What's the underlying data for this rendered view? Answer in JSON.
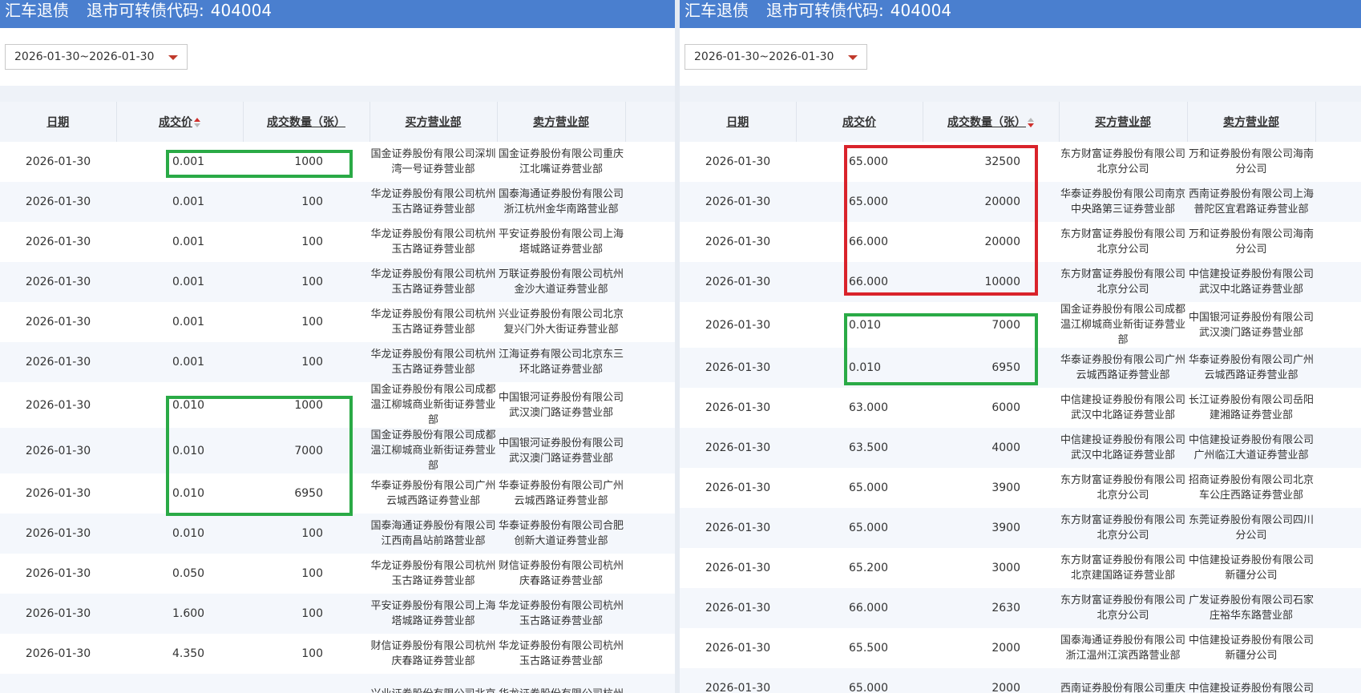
{
  "left": {
    "title": "汇车退债",
    "code_label": "退市可转债代码:",
    "code_value": "404004",
    "date_range": "2026-01-30~2026-01-30",
    "columns": [
      "日期",
      "成交价",
      "成交数量（张）",
      "买方营业部",
      "卖方营业部"
    ],
    "rows": [
      {
        "date": "2026-01-30",
        "price": "0.001",
        "qty": "1000",
        "buyer": "国金证券股份有限公司深圳湾一号证券营业部",
        "seller": "国金证券股份有限公司重庆江北嘴证券营业部"
      },
      {
        "date": "2026-01-30",
        "price": "0.001",
        "qty": "100",
        "buyer": "华龙证券股份有限公司杭州玉古路证券营业部",
        "seller": "国泰海通证券股份有限公司浙江杭州金华南路营业部"
      },
      {
        "date": "2026-01-30",
        "price": "0.001",
        "qty": "100",
        "buyer": "华龙证券股份有限公司杭州玉古路证券营业部",
        "seller": "平安证券股份有限公司上海塔城路证券营业部"
      },
      {
        "date": "2026-01-30",
        "price": "0.001",
        "qty": "100",
        "buyer": "华龙证券股份有限公司杭州玉古路证券营业部",
        "seller": "万联证券股份有限公司杭州金沙大道证券营业部"
      },
      {
        "date": "2026-01-30",
        "price": "0.001",
        "qty": "100",
        "buyer": "华龙证券股份有限公司杭州玉古路证券营业部",
        "seller": "兴业证券股份有限公司北京复兴门外大街证券营业部"
      },
      {
        "date": "2026-01-30",
        "price": "0.001",
        "qty": "100",
        "buyer": "华龙证券股份有限公司杭州玉古路证券营业部",
        "seller": "江海证券有限公司北京东三环北路证券营业部"
      },
      {
        "date": "2026-01-30",
        "price": "0.010",
        "qty": "1000",
        "buyer": "国金证券股份有限公司成都温江柳城商业新街证券营业部",
        "seller": "中国银河证券股份有限公司武汉澳门路证券营业部"
      },
      {
        "date": "2026-01-30",
        "price": "0.010",
        "qty": "7000",
        "buyer": "国金证券股份有限公司成都温江柳城商业新街证券营业部",
        "seller": "中国银河证券股份有限公司武汉澳门路证券营业部"
      },
      {
        "date": "2026-01-30",
        "price": "0.010",
        "qty": "6950",
        "buyer": "华泰证券股份有限公司广州云城西路证券营业部",
        "seller": "华泰证券股份有限公司广州云城西路证券营业部"
      },
      {
        "date": "2026-01-30",
        "price": "0.010",
        "qty": "100",
        "buyer": "国泰海通证券股份有限公司江西南昌站前路营业部",
        "seller": "华泰证券股份有限公司合肥创新大道证券营业部"
      },
      {
        "date": "2026-01-30",
        "price": "0.050",
        "qty": "100",
        "buyer": "华龙证券股份有限公司杭州玉古路证券营业部",
        "seller": "财信证券股份有限公司杭州庆春路证券营业部"
      },
      {
        "date": "2026-01-30",
        "price": "1.600",
        "qty": "100",
        "buyer": "平安证券股份有限公司上海塔城路证券营业部",
        "seller": "华龙证券股份有限公司杭州玉古路证券营业部"
      },
      {
        "date": "2026-01-30",
        "price": "4.350",
        "qty": "100",
        "buyer": "财信证券股份有限公司杭州庆春路证券营业部",
        "seller": "华龙证券股份有限公司杭州玉古路证券营业部"
      },
      {
        "date": "",
        "price": "",
        "qty": "",
        "buyer": "兴业证券股份有限公司北京",
        "seller": "华龙证券股份有限公司杭州"
      }
    ]
  },
  "right": {
    "title": "汇车退债",
    "code_label": "退市可转债代码:",
    "code_value": "404004",
    "date_range": "2026-01-30~2026-01-30",
    "columns": [
      "日期",
      "成交价",
      "成交数量（张）",
      "买方营业部",
      "卖方营业部"
    ],
    "rows": [
      {
        "date": "2026-01-30",
        "price": "65.000",
        "qty": "32500",
        "buyer": "东方财富证券股份有限公司北京分公司",
        "seller": "万和证券股份有限公司海南分公司"
      },
      {
        "date": "2026-01-30",
        "price": "65.000",
        "qty": "20000",
        "buyer": "华泰证券股份有限公司南京中央路第三证券营业部",
        "seller": "西南证券股份有限公司上海普陀区宜君路证券营业部"
      },
      {
        "date": "2026-01-30",
        "price": "66.000",
        "qty": "20000",
        "buyer": "东方财富证券股份有限公司北京分公司",
        "seller": "万和证券股份有限公司海南分公司"
      },
      {
        "date": "2026-01-30",
        "price": "66.000",
        "qty": "10000",
        "buyer": "东方财富证券股份有限公司北京分公司",
        "seller": "中信建投证券股份有限公司武汉中北路证券营业部"
      },
      {
        "date": "2026-01-30",
        "price": "0.010",
        "qty": "7000",
        "buyer": "国金证券股份有限公司成都温江柳城商业新街证券营业部",
        "seller": "中国银河证券股份有限公司武汉澳门路证券营业部"
      },
      {
        "date": "2026-01-30",
        "price": "0.010",
        "qty": "6950",
        "buyer": "华泰证券股份有限公司广州云城西路证券营业部",
        "seller": "华泰证券股份有限公司广州云城西路证券营业部"
      },
      {
        "date": "2026-01-30",
        "price": "63.000",
        "qty": "6000",
        "buyer": "中信建投证券股份有限公司武汉中北路证券营业部",
        "seller": "长江证券股份有限公司岳阳建湘路证券营业部"
      },
      {
        "date": "2026-01-30",
        "price": "63.500",
        "qty": "4000",
        "buyer": "中信建投证券股份有限公司武汉中北路证券营业部",
        "seller": "中信建投证券股份有限公司广州临江大道证券营业部"
      },
      {
        "date": "2026-01-30",
        "price": "65.000",
        "qty": "3900",
        "buyer": "东方财富证券股份有限公司北京分公司",
        "seller": "招商证券股份有限公司北京车公庄西路证券营业部"
      },
      {
        "date": "2026-01-30",
        "price": "65.000",
        "qty": "3900",
        "buyer": "东方财富证券股份有限公司北京分公司",
        "seller": "东莞证券股份有限公司四川分公司"
      },
      {
        "date": "2026-01-30",
        "price": "65.200",
        "qty": "3000",
        "buyer": "东方财富证券股份有限公司北京建国路证券营业部",
        "seller": "中信建投证券股份有限公司新疆分公司"
      },
      {
        "date": "2026-01-30",
        "price": "66.000",
        "qty": "2630",
        "buyer": "东方财富证券股份有限公司北京分公司",
        "seller": "广发证券股份有限公司石家庄裕华东路营业部"
      },
      {
        "date": "2026-01-30",
        "price": "65.500",
        "qty": "2000",
        "buyer": "国泰海通证券股份有限公司浙江温州江滨西路营业部",
        "seller": "中信建投证券股份有限公司新疆分公司"
      },
      {
        "date": "2026-01-30",
        "price": "65.000",
        "qty": "2000",
        "buyer": "西南证券股份有限公司重庆",
        "seller": "中信建投证券股份有限公司"
      }
    ]
  },
  "colors": {
    "header_bg": "#4a7fcf",
    "highlight_green": "#2aaa46",
    "highlight_red": "#d9232b",
    "sort_arrow": "#d0312d"
  }
}
